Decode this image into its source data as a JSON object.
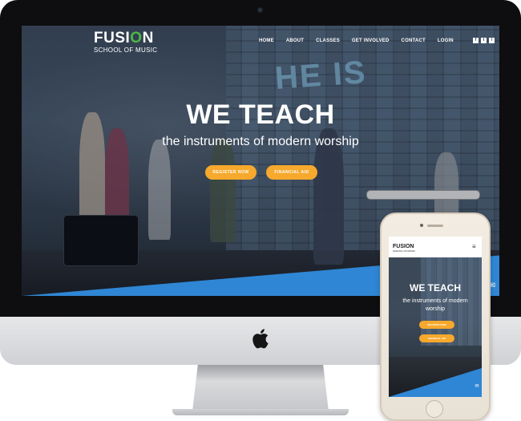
{
  "brand": {
    "name_pre": "FUSI",
    "name_o": "O",
    "name_post": "N",
    "tagline": "SCHOOL OF MUSIC"
  },
  "nav": {
    "items": [
      "HOME",
      "ABOUT",
      "CLASSES",
      "GET INVOLVED",
      "CONTACT",
      "LOGIN"
    ]
  },
  "social": [
    "f",
    "t",
    "i"
  ],
  "hero": {
    "title": "WE TEACH",
    "subtitle": "the instruments of modern worship",
    "register_label": "REGISTER NOW",
    "aid_label": "FINANCIAL AID",
    "wall_text": "HE IS"
  },
  "mobile": {
    "logo": "FUSION",
    "logo_sub": "SCHOOL OF MUSIC",
    "menu_icon": "≡",
    "title": "WE TEACH",
    "subtitle": "the instruments of modern worship",
    "register_label": "REGISTER NOW",
    "aid_label": "FINANCIAL AID"
  },
  "icons": {
    "chat": "✉",
    "apple": ""
  },
  "colors": {
    "accent_orange": "#f6a92c",
    "accent_blue": "#2f86d4",
    "logo_green": "#4cb848"
  }
}
